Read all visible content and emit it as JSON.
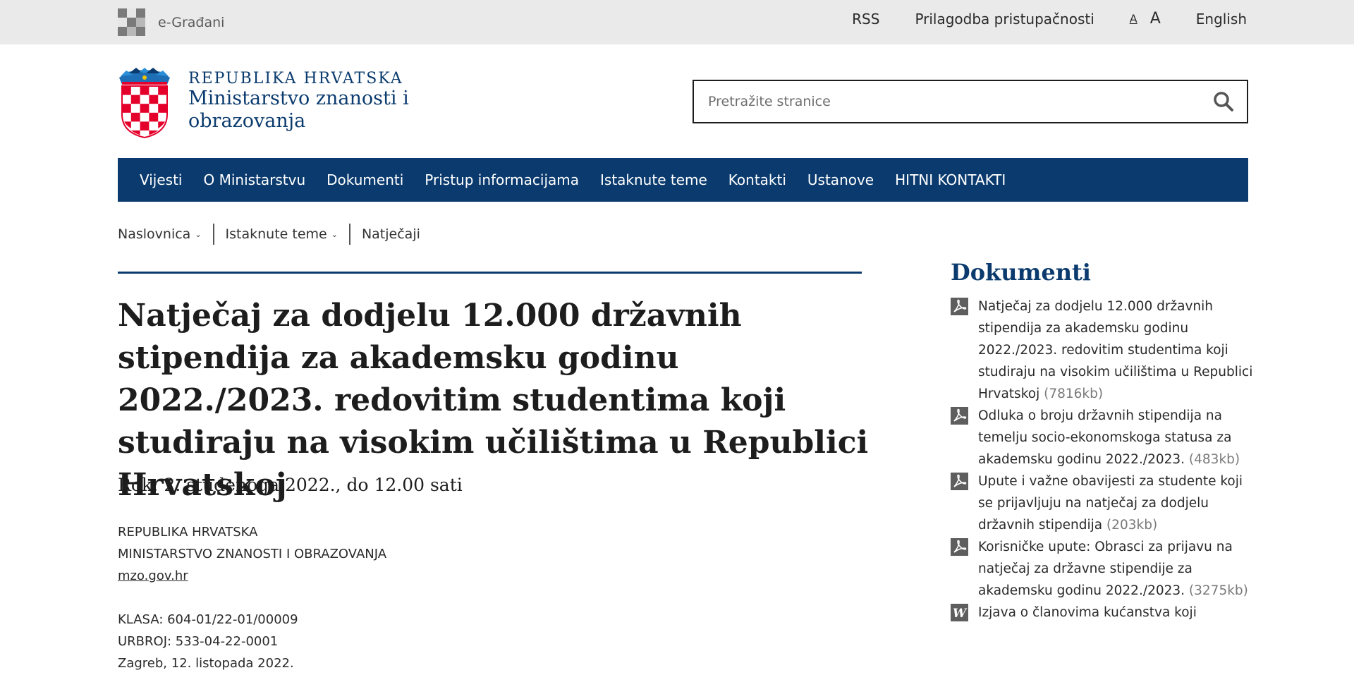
{
  "topbar": {
    "egradjani": "e-Građani",
    "links": {
      "rss": "RSS",
      "accessibility": "Prilagodba pristupačnosti",
      "font_small": "A",
      "font_large": "A",
      "english": "English"
    }
  },
  "header": {
    "org_line1": "REPUBLIKA HRVATSKA",
    "org_line2": "Ministarstvo znanosti i",
    "org_line3": "obrazovanja"
  },
  "search": {
    "placeholder": "Pretražite stranice"
  },
  "nav": {
    "items": [
      "Vijesti",
      "O Ministarstvu",
      "Dokumenti",
      "Pristup informacijama",
      "Istaknute teme",
      "Kontakti",
      "Ustanove",
      "HITNI KONTAKTI"
    ]
  },
  "breadcrumb": [
    "Naslovnica",
    "Istaknute teme",
    "Natječaji"
  ],
  "article": {
    "title": "Natječaj za dodjelu 12.000 državnih stipendija za akademsku godinu 2022./2023. redovitim studentima koji studiraju na visokim učilištima u Republici Hrvatskoj",
    "deadline": "Rok: 2. studenoga 2022., do 12.00 sati",
    "meta": {
      "line1": "REPUBLIKA HRVATSKA",
      "line2": "MINISTARSTVO ZNANOSTI I OBRAZOVANJA",
      "link": "mzo.gov.hr",
      "klasa": "KLASA: 604-01/22-01/00009",
      "urbroj": "URBROJ: 533-04-22-0001",
      "place_date": "Zagreb, 12. listopada 2022."
    }
  },
  "sidebar": {
    "title": "Dokumenti",
    "docs": [
      {
        "icon": "pdf-icon",
        "title": "Natječaj za dodjelu 12.000 državnih stipendija za akademsku godinu 2022./2023. redovitim studentima koji studiraju na visokim učilištima u Republici Hrvatskoj",
        "size": "(7816kb)"
      },
      {
        "icon": "pdf-icon",
        "title": "Odluka o broju državnih stipendija na temelju socio-ekonomskoga statusa za akademsku godinu 2022./2023.",
        "size": "(483kb)"
      },
      {
        "icon": "pdf-icon",
        "title": "Upute i važne obavijesti za studente koji se prijavljuju na natječaj za dodjelu državnih stipendija",
        "size": "(203kb)"
      },
      {
        "icon": "pdf-icon",
        "title": "Korisničke upute: Obrasci za prijavu na natječaj za državne stipendije za akademsku godinu 2022./2023.",
        "size": "(3275kb)"
      },
      {
        "icon": "word-icon",
        "title": "Izjava o članovima kućanstva koji",
        "size": ""
      }
    ]
  },
  "colors": {
    "brand_blue": "#0b3b6e",
    "topbar_bg": "#eaeaea",
    "crest_red": "#e4002b"
  }
}
